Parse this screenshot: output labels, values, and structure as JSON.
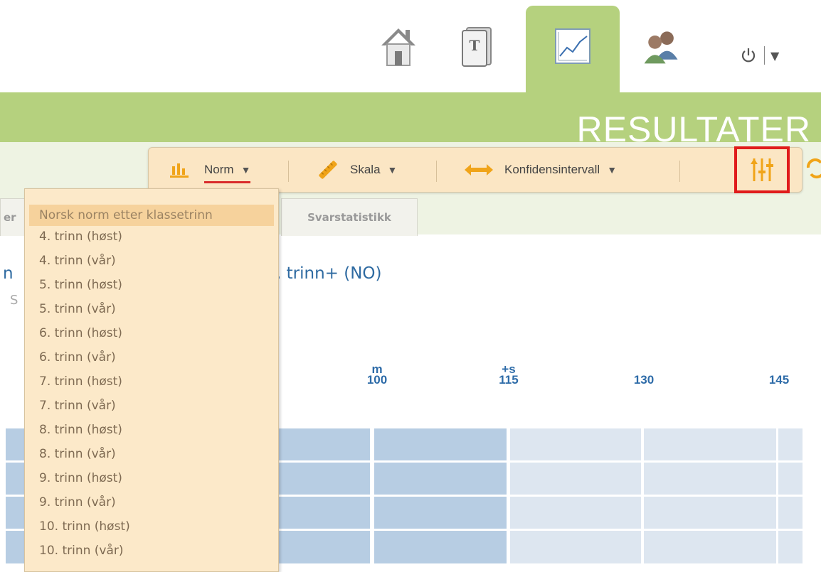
{
  "nav": {
    "items": [
      {
        "name": "home",
        "icon": "home-icon"
      },
      {
        "name": "tests",
        "icon": "book-icon"
      },
      {
        "name": "results",
        "icon": "chart-icon",
        "active": true
      },
      {
        "name": "users",
        "icon": "users-icon"
      }
    ],
    "power_icon": "power-icon",
    "menu_caret": "▼"
  },
  "page_title": "RESULTATER",
  "toolbar": {
    "norm_label": "Norm",
    "scale_label": "Skala",
    "confidence_label": "Konfidensintervall",
    "caret": "▼",
    "settings_icon": "sliders-icon"
  },
  "tabs": {
    "left_partial": "er",
    "answer_stats": "Svarstatistikk"
  },
  "content": {
    "heading_left": "n",
    "heading_right": ". trinn+ (NO)",
    "sub_letter": "S"
  },
  "axis": {
    "ticks": [
      {
        "marker": "m",
        "value": "100"
      },
      {
        "marker": "+s",
        "value": "115"
      },
      {
        "marker": "",
        "value": "130"
      },
      {
        "marker": "",
        "value": "145"
      }
    ]
  },
  "norm_dropdown": {
    "selected": "Norsk norm etter klassetrinn",
    "options": [
      "Norsk norm etter klassetrinn",
      "4. trinn (høst)",
      "4. trinn (vår)",
      "5. trinn (høst)",
      "5. trinn (vår)",
      "6. trinn (høst)",
      "6. trinn (vår)",
      "7. trinn (høst)",
      "7. trinn (vår)",
      "8. trinn (høst)",
      "8. trinn (vår)",
      "9. trinn (høst)",
      "9. trinn (vår)",
      "10. trinn (høst)",
      "10. trinn (vår)"
    ]
  },
  "colors": {
    "accent_green": "#b5d17e",
    "toolbar_bg": "#fbe6c4",
    "dropdown_bg": "#fce9c9",
    "selected_bg": "#f6d29c",
    "axis_blue": "#2d6ba8",
    "highlight_red": "#e01b1b",
    "toolbar_icon_orange": "#f0a419"
  }
}
